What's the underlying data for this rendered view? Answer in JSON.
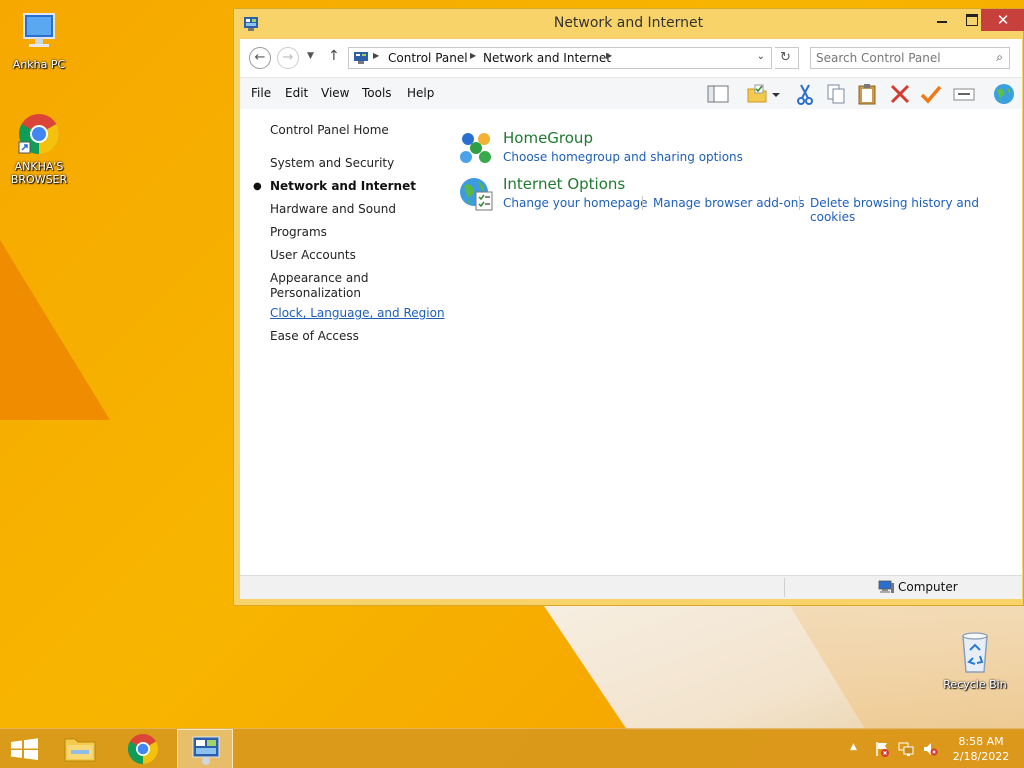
{
  "desktop": {
    "icons": [
      {
        "label": "Ankha PC",
        "icon": "computer-icon"
      },
      {
        "label": "ANKHA'S BROWSER",
        "icon": "chrome-icon"
      },
      {
        "label": "Recycle Bin",
        "icon": "recycle-bin-icon"
      }
    ]
  },
  "window": {
    "title": "Network and Internet",
    "close_glyph": "✕"
  },
  "address_bar": {
    "crumbs": [
      "Control Panel",
      "Network and Internet"
    ],
    "search_placeholder": "Search Control Panel"
  },
  "menu": {
    "items": [
      "File",
      "Edit",
      "View",
      "Tools",
      "Help"
    ]
  },
  "toolbar": {
    "icons": [
      "pane-icon",
      "folder-options-icon",
      "cut-icon",
      "copy-icon",
      "paste-icon",
      "delete-icon",
      "properties-check-icon",
      "rename-icon",
      "globe-icon"
    ]
  },
  "sidebar": {
    "home": "Control Panel Home",
    "items": [
      {
        "label": "System and Security"
      },
      {
        "label": "Network and Internet",
        "current": true
      },
      {
        "label": "Hardware and Sound"
      },
      {
        "label": "Programs"
      },
      {
        "label": "User Accounts"
      },
      {
        "label": "Appearance and Personalization",
        "line1": "Appearance and",
        "line2": "Personalization"
      },
      {
        "label": "Clock, Language, and Region",
        "hover": true
      },
      {
        "label": "Ease of Access"
      }
    ],
    "bullet": "●"
  },
  "categories": [
    {
      "title": "HomeGroup",
      "icon": "homegroup-icon",
      "links": [
        "Choose homegroup and sharing options"
      ]
    },
    {
      "title": "Internet Options",
      "icon": "internet-options-icon",
      "links": [
        "Change your homepage",
        "Manage browser add-ons",
        "Delete browsing history and cookies"
      ]
    }
  ],
  "statusbar": {
    "location": "Computer"
  },
  "taskbar": {
    "clock_time": "8:58 AM",
    "clock_date": "2/18/2022",
    "tray_up": "▲"
  },
  "colors": {
    "title_bar": "#f8d36a",
    "close_button": "#c7403b",
    "category_title": "#1f7a2f",
    "link": "#1d5fb7"
  }
}
